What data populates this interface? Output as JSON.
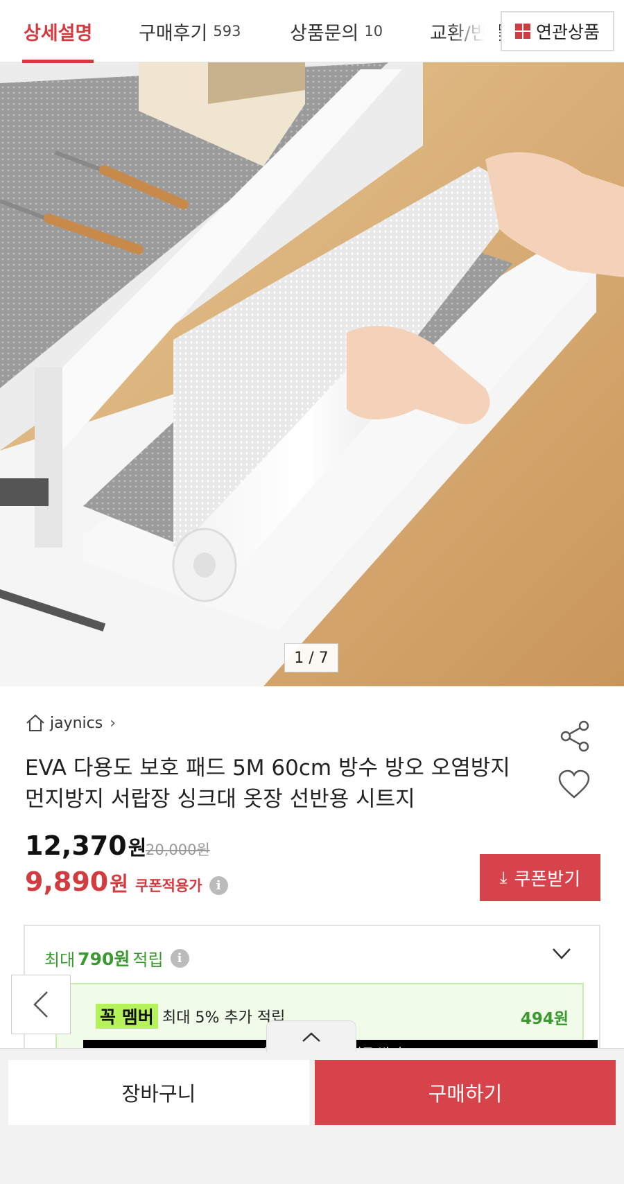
{
  "tabs": [
    {
      "label": "상세설명",
      "count": ""
    },
    {
      "label": "구매후기",
      "count": "593"
    },
    {
      "label": "상품문의",
      "count": "10"
    },
    {
      "label": "교환/반품",
      "count": ""
    }
  ],
  "related_button": "연관상품",
  "image_counter": "1 / 7",
  "seller": "jaynics",
  "product_title": "EVA 다용도 보호 패드 5M 60cm 방수 방오 오염방지 먼지방지 서랍장 싱크대 옷장 선반용 시트지",
  "price": {
    "amount": "12,370",
    "unit": "원",
    "original": "20,000원"
  },
  "coupon_price": {
    "amount": "9,890",
    "unit": "원",
    "note": "쿠폰적용가"
  },
  "coupon_button": "쿠폰받기",
  "reward": {
    "prefix": "최대",
    "amount": "790원",
    "suffix": "적립",
    "member_badge": "꼭 멤버",
    "member_text": "최대 5% 추가 적립",
    "member_amount": "494원",
    "member_bar": "꼭! 시작하고 적립금 받기 >"
  },
  "bottom": {
    "cart": "장바구니",
    "buy": "구매하기"
  },
  "colors": {
    "accent": "#d23b3f",
    "green": "#3a9a2f"
  }
}
